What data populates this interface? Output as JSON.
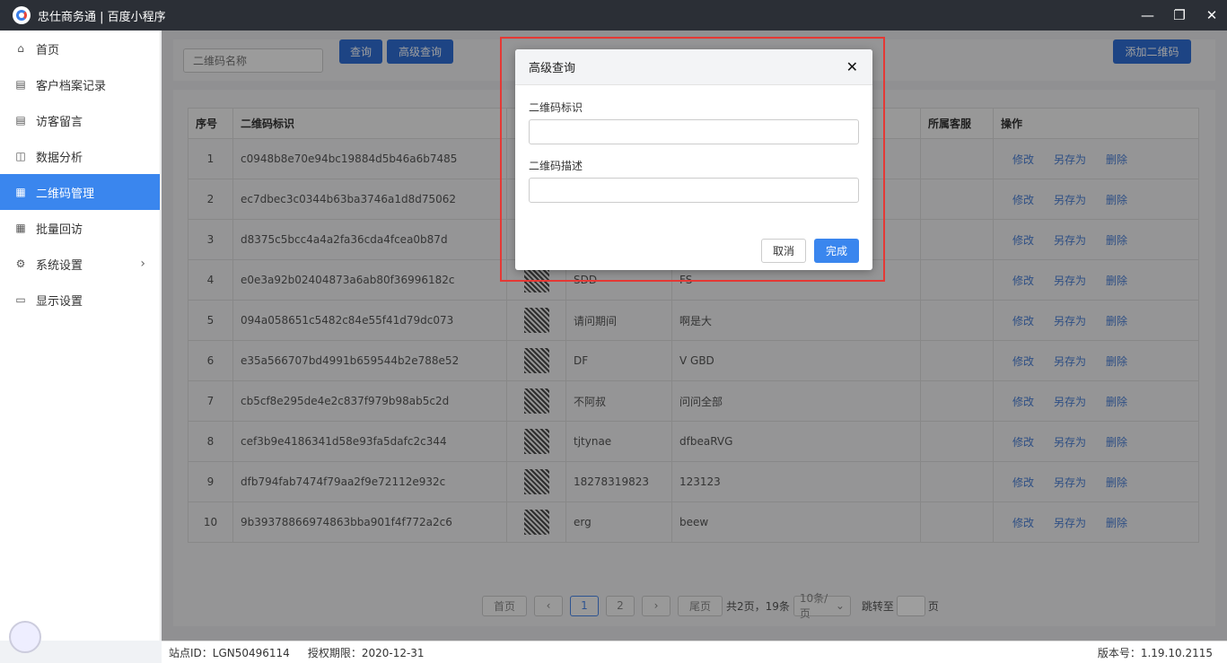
{
  "window": {
    "title": "忠仕商务通 | 百度小程序",
    "minimize": "—",
    "restore": "❐",
    "close": "✕"
  },
  "sidebar": {
    "items": [
      {
        "label": "首页",
        "icon": "home-icon",
        "glyph": "⌂",
        "active": false
      },
      {
        "label": "客户档案记录",
        "icon": "id-card-icon",
        "glyph": "▤",
        "active": false
      },
      {
        "label": "访客留言",
        "icon": "message-icon",
        "glyph": "▤",
        "active": false
      },
      {
        "label": "数据分析",
        "icon": "chart-icon",
        "glyph": "◫",
        "active": false
      },
      {
        "label": "二维码管理",
        "icon": "qrcode-icon",
        "glyph": "▦",
        "active": true
      },
      {
        "label": "批量回访",
        "icon": "grid-icon",
        "glyph": "▦",
        "active": false
      },
      {
        "label": "系统设置",
        "icon": "gear-icon",
        "glyph": "⚙",
        "active": false,
        "chevron": "›"
      },
      {
        "label": "显示设置",
        "icon": "monitor-icon",
        "glyph": "▭",
        "active": false
      }
    ]
  },
  "toolbar": {
    "search_placeholder": "二维码名称",
    "query_label": "查询",
    "advanced_label": "高级查询",
    "add_label": "添加二维码"
  },
  "table": {
    "headers": [
      "序号",
      "二维码标识",
      "",
      "",
      "",
      "所属客服",
      "操作"
    ],
    "ops": [
      "修改",
      "另存为",
      "删除"
    ],
    "rows": [
      {
        "no": "1",
        "id": "c0948b8e70e94bc19884d5b46a6b7485",
        "name": "",
        "desc": ""
      },
      {
        "no": "2",
        "id": "ec7dbec3c0344b63ba3746a1d8d75062",
        "name": "",
        "desc": ""
      },
      {
        "no": "3",
        "id": "d8375c5bcc4a4a2fa36cda4fcea0b87d",
        "name": "",
        "desc": ""
      },
      {
        "no": "4",
        "id": "e0e3a92b02404873a6ab80f36996182c",
        "name": "SDD",
        "desc": "FS"
      },
      {
        "no": "5",
        "id": "094a058651c5482c84e55f41d79dc073",
        "name": "请问期间",
        "desc": "啊是大"
      },
      {
        "no": "6",
        "id": "e35a566707bd4991b659544b2e788e52",
        "name": "DF",
        "desc": "V GBD"
      },
      {
        "no": "7",
        "id": "cb5cf8e295de4e2c837f979b98ab5c2d",
        "name": "不阿叔",
        "desc": "问问全部"
      },
      {
        "no": "8",
        "id": "cef3b9e4186341d58e93fa5dafc2c344",
        "name": "tjtynae",
        "desc": "dfbeaRVG"
      },
      {
        "no": "9",
        "id": "dfb794fab7474f79aa2f9e72112e932c",
        "name": "18278319823",
        "desc": "123123"
      },
      {
        "no": "10",
        "id": "9b39378866974863bba901f4f772a2c6",
        "name": "erg",
        "desc": "beew"
      }
    ]
  },
  "pager": {
    "first": "首页",
    "prev": "‹",
    "pages": [
      "1",
      "2"
    ],
    "next": "›",
    "last": "尾页",
    "summary": "共2页，19条",
    "page_size": "10条/页",
    "jump_label": "跳转至",
    "jump_suffix": "页"
  },
  "status": {
    "site": "站点ID：LGN50496114",
    "license": "授权期限：2020-12-31",
    "version": "版本号：1.19.10.2115"
  },
  "modal": {
    "title": "高级查询",
    "close": "✕",
    "field1_label": "二维码标识",
    "field2_label": "二维码描述",
    "cancel_label": "取消",
    "ok_label": "完成"
  },
  "colors": {
    "accent": "#3a86ee",
    "highlight": "#e53935"
  }
}
